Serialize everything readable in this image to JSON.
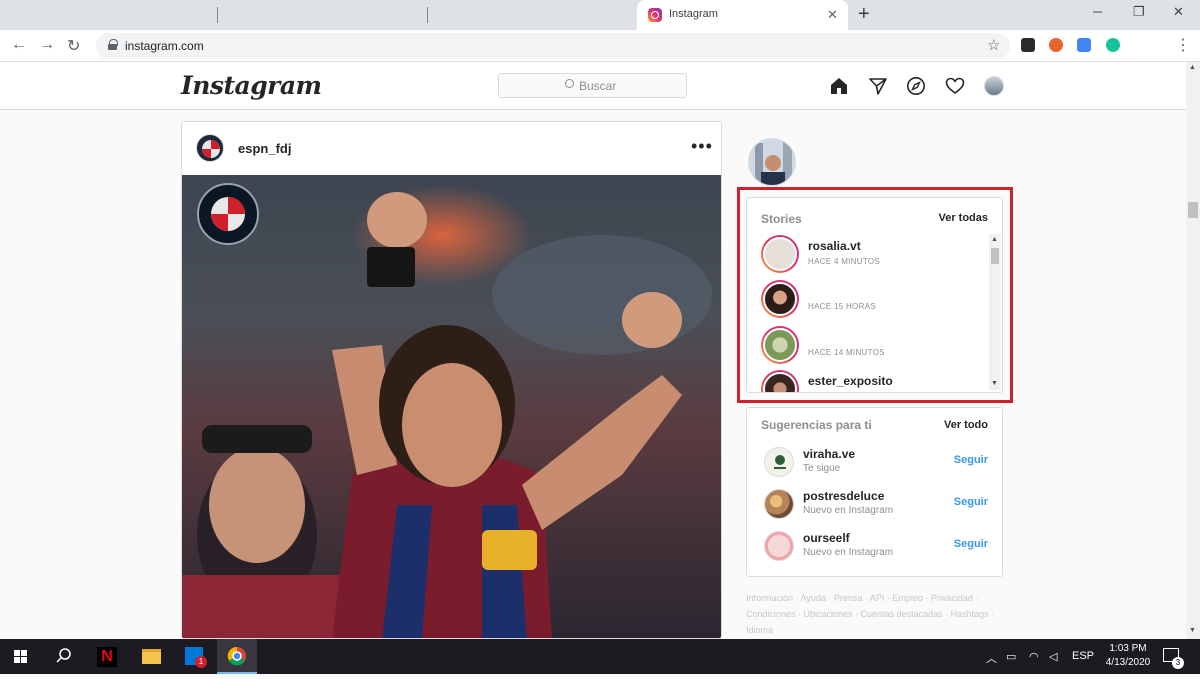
{
  "browser": {
    "tab_title": "Instagram",
    "url": "instagram.com",
    "new_tab": "+",
    "close": "✕"
  },
  "ig": {
    "logo": "Instagram",
    "search_placeholder": "Buscar"
  },
  "post": {
    "username": "espn_fdj",
    "more": "•••"
  },
  "stories": {
    "title": "Stories",
    "see_all": "Ver todas",
    "items": [
      {
        "name": "rosalia.vt",
        "time": "HACE 4 MINUTOS"
      },
      {
        "name": "",
        "time": "HACE 15 HORAS"
      },
      {
        "name": "",
        "time": "HACE 14 MINUTOS"
      },
      {
        "name": "ester_exposito",
        "time": ""
      }
    ]
  },
  "suggestions": {
    "title": "Sugerencias para ti",
    "see_all": "Ver todo",
    "items": [
      {
        "name": "viraha.ve",
        "sub": "Te sigue",
        "action": "Seguir"
      },
      {
        "name": "postresdeluce",
        "sub": "Nuevo en Instagram",
        "action": "Seguir"
      },
      {
        "name": "ourseelf",
        "sub": "Nuevo en Instagram",
        "action": "Seguir"
      }
    ]
  },
  "footer": "Información · Ayuda · Prensa · API · Empleo · Privacidad · Condiciones · Ubicaciones · Cuentas destacadas · Hashtags · Idioma",
  "taskbar": {
    "lang": "ESP",
    "time": "1:03 PM",
    "date": "4/13/2020",
    "notification_count": "3",
    "badge": "1"
  },
  "colors": {
    "highlight": "#d0202c",
    "link_blue": "#3897f0",
    "story_ring": "#e1306c"
  }
}
